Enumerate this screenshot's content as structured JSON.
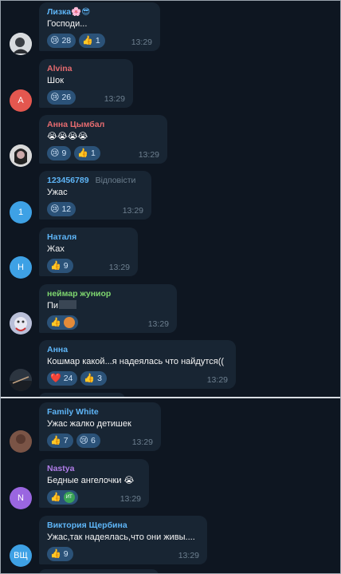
{
  "colors": {
    "background": "#0e1621",
    "bubble": "#182533",
    "reaction_pill": "#2b5278",
    "time": "#6d7f8f"
  },
  "messages_top": [
    {
      "name": "Лизка🌸😎",
      "name_color": "#5eb5f7",
      "text": "Господи...",
      "reactions": [
        {
          "emoji": "😢",
          "count": "28"
        },
        {
          "emoji": "👍",
          "count": "1"
        }
      ],
      "time": "13:29",
      "avatar": {
        "initials": "",
        "color": "#cfd3d6",
        "icon": "photo"
      }
    },
    {
      "name": "Alvina",
      "name_color": "#e56b6f",
      "text": "Шок",
      "reactions": [
        {
          "emoji": "😢",
          "count": "26"
        }
      ],
      "time": "13:29",
      "avatar": {
        "initials": "A",
        "color": "#e4574f"
      }
    },
    {
      "name": "Анна Цымбал",
      "name_color": "#e56b6f",
      "text": "😭😭😭😭",
      "reactions": [
        {
          "emoji": "😢",
          "count": "9"
        },
        {
          "emoji": "👍",
          "count": "1"
        }
      ],
      "time": "13:29",
      "avatar": {
        "initials": "",
        "color": "#c9c9c9",
        "icon": "photo"
      }
    },
    {
      "name": "123456789",
      "name_color": "#5eb5f7",
      "reply_label": "Відповісти",
      "text": "Ужас",
      "reactions": [
        {
          "emoji": "😢",
          "count": "12"
        }
      ],
      "time": "13:29",
      "avatar": {
        "initials": "1",
        "color": "#3ea1e5"
      }
    },
    {
      "name": "Наталя",
      "name_color": "#5eb5f7",
      "text": "Жах",
      "reactions": [
        {
          "emoji": "👍",
          "count": "9"
        }
      ],
      "time": "13:29",
      "avatar": {
        "initials": "Н",
        "color": "#3ea1e5"
      }
    },
    {
      "name": "неймар жуниор",
      "name_color": "#7ed66f",
      "text": "Пи",
      "reactions": [
        {
          "emoji": "👍",
          "count": ""
        }
      ],
      "time": "13:29",
      "avatar": {
        "initials": "",
        "color": "#8a8fb0",
        "icon": "photo"
      }
    },
    {
      "name": "Анна",
      "name_color": "#5eb5f7",
      "text": "Кошмар какой...я надеялась что найдутся((",
      "reactions": [
        {
          "emoji": "❤️",
          "count": "24"
        },
        {
          "emoji": "👍",
          "count": "3"
        }
      ],
      "time": "13:29",
      "avatar": {
        "initials": "",
        "color": "#2a3340",
        "icon": "photo"
      }
    }
  ],
  "messages_bottom": [
    {
      "name": "Family White",
      "name_color": "#5eb5f7",
      "text": "Ужас жалко детишек",
      "reactions": [
        {
          "emoji": "👍",
          "count": "7"
        },
        {
          "emoji": "😢",
          "count": "6"
        }
      ],
      "time": "13:29",
      "avatar": {
        "initials": "",
        "color": "#6b4a3e",
        "icon": "photo"
      }
    },
    {
      "name": "Nastya",
      "name_color": "#b07de8",
      "text": "Бедные ангелочки 😭",
      "reactions": [
        {
          "emoji": "👍",
          "count": ""
        }
      ],
      "time": "13:29",
      "avatar": {
        "initials": "N",
        "color": "#9a66e0"
      }
    },
    {
      "name": "Виктория Щербина",
      "name_color": "#5eb5f7",
      "text": "Ужас,так надеялась,что они живы....",
      "reactions": [
        {
          "emoji": "👍",
          "count": "9"
        }
      ],
      "time": "13:29",
      "avatar": {
        "initials": "ВЩ",
        "color": "#3ea1e5"
      }
    }
  ],
  "extra_reactor_badges": {
    "neymar": {
      "color": "#e38b3a"
    },
    "nastya": {
      "label": "ИТ",
      "color": "#3aa356"
    }
  }
}
